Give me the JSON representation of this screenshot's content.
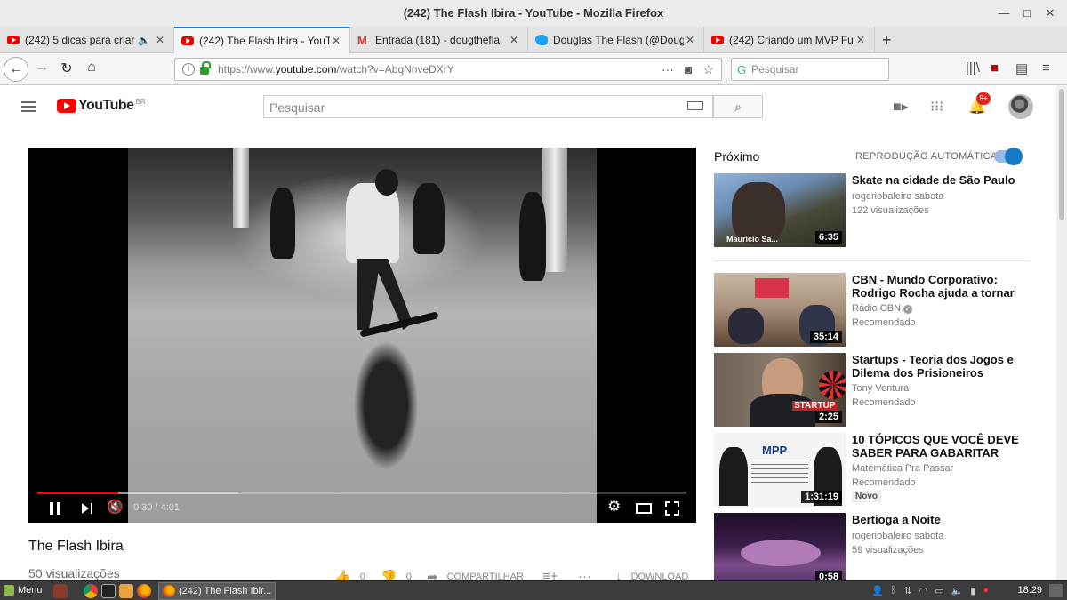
{
  "window": {
    "title": "(242) The Flash Ibira - YouTube - Mozilla Firefox"
  },
  "tabs": [
    {
      "label": "(242) 5 dicas para criar",
      "favicon": "youtube-icon",
      "audio": true
    },
    {
      "label": "(242) The Flash Ibira - YouTub",
      "favicon": "youtube-icon",
      "active": true
    },
    {
      "label": "Entrada (181) - dougthefla",
      "favicon": "gmail-icon"
    },
    {
      "label": "Douglas The Flash (@Doug",
      "favicon": "twitter-icon"
    },
    {
      "label": "(242) Criando um MVP Fun",
      "favicon": "youtube-icon"
    }
  ],
  "address": {
    "prefix": "https://www.",
    "domain": "youtube.com",
    "path": "/watch?v=AbqNnveDXrY"
  },
  "search": {
    "placeholder": "Pesquisar"
  },
  "youtube": {
    "logo": "YouTube",
    "region": "BR",
    "search_placeholder": "Pesquisar",
    "notification_count": "9+"
  },
  "player": {
    "current_time": "0:30",
    "duration": "4:01",
    "time_display": "0:30 / 4:01",
    "played_fraction": 0.124,
    "buffered_fraction": 0.31
  },
  "video": {
    "title": "The Flash Ibira",
    "views": "50 visualizações",
    "likes": "0",
    "dislikes": "0",
    "share_label": "COMPARTILHAR",
    "download_label": "DOWNLOAD"
  },
  "sidebar": {
    "next_label": "Próximo",
    "autoplay_label": "REPRODUÇÃO AUTOMÁTICA",
    "autoplay_on": true,
    "items": [
      {
        "title": "Skate na cidade de São Paulo",
        "channel": "rogeriobaleiro sabota",
        "meta": "122 visualizações",
        "duration": "6:35",
        "thumb_text": "Maurício Sa..."
      },
      {
        "title": "CBN - Mundo Corporativo: Rodrigo Rocha ajuda a tornar",
        "channel": "Rádio CBN",
        "verified": true,
        "meta": "Recomendado",
        "duration": "35:14"
      },
      {
        "title": "Startups - Teoria dos Jogos e Dilema dos Prisioneiros",
        "channel": "Tony Ventura",
        "meta": "Recomendado",
        "duration": "2:25",
        "thumb_text": "STARTUP"
      },
      {
        "title": "10 TÓPICOS QUE VOCÊ DEVE SABER PARA GABARITAR",
        "channel": "Matemática Pra Passar",
        "meta": "Recomendado",
        "badge": "Novo",
        "duration": "1:31:19",
        "thumb_text": "MPP"
      },
      {
        "title": "Bertioga a Noite",
        "channel": "rogeriobaleiro sabota",
        "meta": "59 visualizações",
        "duration": "0:58"
      }
    ]
  },
  "taskbar": {
    "menu_label": "Menu",
    "task_label": "(242) The Flash Ibir...",
    "clock": "18:29"
  },
  "colors": {
    "youtube_red": "#ff0000",
    "accent_blue": "#167ac6",
    "firefox_tab_accent": "#0a84ff"
  }
}
